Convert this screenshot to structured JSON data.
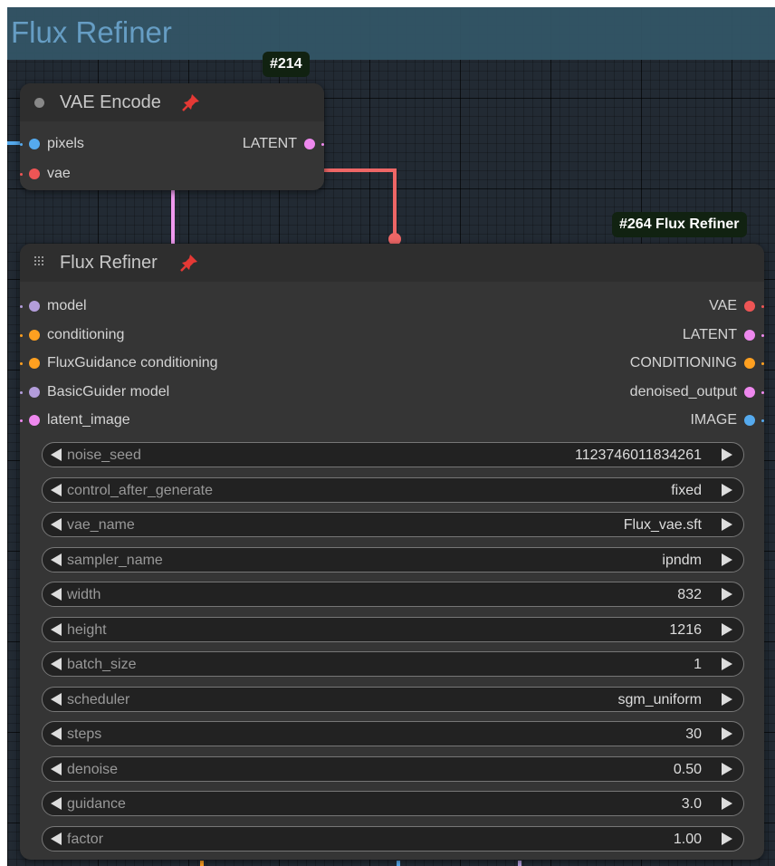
{
  "colors": {
    "image": "#55aaee",
    "vae": "#ee5555",
    "latent": "#ee88ee",
    "model": "#b39ddb",
    "conditioning": "#ffa020",
    "wire_vae": "#ee6666",
    "wire_latent": "#ee99ee"
  },
  "group": {
    "title": "Flux Refiner"
  },
  "vae_encode": {
    "badge": "#214",
    "title": "VAE Encode",
    "inputs": [
      {
        "label": "pixels",
        "type": "image"
      },
      {
        "label": "vae",
        "type": "vae"
      }
    ],
    "outputs": [
      {
        "label": "LATENT",
        "type": "latent"
      }
    ]
  },
  "flux_refiner": {
    "badge": "#264 Flux Refiner",
    "title": "Flux Refiner",
    "inputs": [
      {
        "label": "model",
        "type": "model"
      },
      {
        "label": "conditioning",
        "type": "conditioning"
      },
      {
        "label": "FluxGuidance conditioning",
        "type": "conditioning"
      },
      {
        "label": "BasicGuider model",
        "type": "model"
      },
      {
        "label": "latent_image",
        "type": "latent"
      }
    ],
    "outputs": [
      {
        "label": "VAE",
        "type": "vae"
      },
      {
        "label": "LATENT",
        "type": "latent"
      },
      {
        "label": "CONDITIONING",
        "type": "conditioning"
      },
      {
        "label": "denoised_output",
        "type": "latent"
      },
      {
        "label": "IMAGE",
        "type": "image"
      }
    ],
    "widgets": [
      {
        "name": "noise_seed",
        "value": "1123746011834261"
      },
      {
        "name": "control_after_generate",
        "value": "fixed"
      },
      {
        "name": "vae_name",
        "value": "Flux_vae.sft"
      },
      {
        "name": "sampler_name",
        "value": "ipndm"
      },
      {
        "name": "width",
        "value": "832"
      },
      {
        "name": "height",
        "value": "1216"
      },
      {
        "name": "batch_size",
        "value": "1"
      },
      {
        "name": "scheduler",
        "value": "sgm_uniform"
      },
      {
        "name": "steps",
        "value": "30"
      },
      {
        "name": "denoise",
        "value": "0.50"
      },
      {
        "name": "guidance",
        "value": "3.0"
      },
      {
        "name": "factor",
        "value": "1.00"
      }
    ]
  }
}
